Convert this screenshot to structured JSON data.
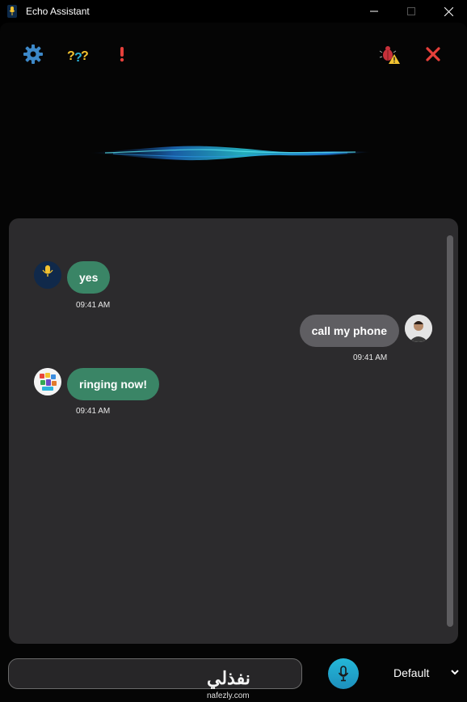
{
  "window": {
    "title": "Echo Assistant",
    "controls": [
      "minimize-icon",
      "maximize-icon",
      "close-icon"
    ]
  },
  "toolbar": {
    "icons": [
      "gear-icon",
      "help-icon",
      "alert-icon",
      "bug-warning-icon",
      "close-x-icon"
    ]
  },
  "chat": {
    "messages": [
      {
        "sender": "bot",
        "text": "yes",
        "time": "09:41 AM"
      },
      {
        "sender": "user",
        "text": "call my phone",
        "time": "09:41 AM"
      },
      {
        "sender": "bot",
        "text": "ringing now!",
        "time": "09:41 AM"
      }
    ],
    "bot_avatar_caption": "Echo Assistant"
  },
  "input": {
    "value": "",
    "voice_selected": "Default"
  },
  "watermark": {
    "arabic": "نفذلي",
    "latin": "nafezly.com"
  },
  "colors": {
    "bot_bubble": "#3a8566",
    "user_bubble": "#5f5e62",
    "panel": "#2c2b2d",
    "accent_red": "#e6403b",
    "mic": "#24b8d8"
  }
}
